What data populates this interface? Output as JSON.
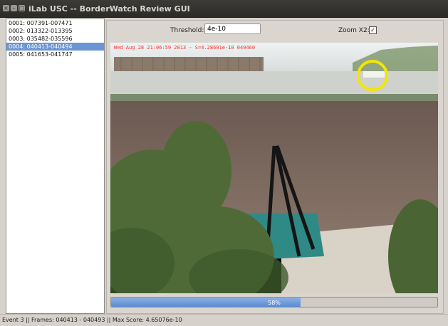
{
  "window": {
    "title": "iLab USC -- BorderWatch Review GUI"
  },
  "events": [
    {
      "label": "0001: 007391-007471",
      "selected": false
    },
    {
      "label": "0002: 013322-013395",
      "selected": false
    },
    {
      "label": "0003: 035482-035596",
      "selected": false
    },
    {
      "label": "0004: 040413-040494",
      "selected": true
    },
    {
      "label": "0005: 041653-041747",
      "selected": false
    }
  ],
  "controls": {
    "threshold_label": "Threshold:",
    "threshold_value": "4e-10",
    "zoom_label": "Zoom X2:",
    "zoom_checked": true,
    "zoom_check_glyph": "✓"
  },
  "video": {
    "timestamp_overlay": "Wed Aug 28 21:06:59 2013 - S=4.28601e-10 040460",
    "highlight_color": "#f3e600"
  },
  "progress": {
    "value": 58,
    "label": "58%"
  },
  "status": {
    "text": "Event 3 || Frames: 040413 - 040493 || Max Score: 4.65076e-10"
  },
  "colors": {
    "selection": "#6b95d3",
    "progress_fill": "#6b95d3",
    "timestamp_text": "#ff3030"
  }
}
